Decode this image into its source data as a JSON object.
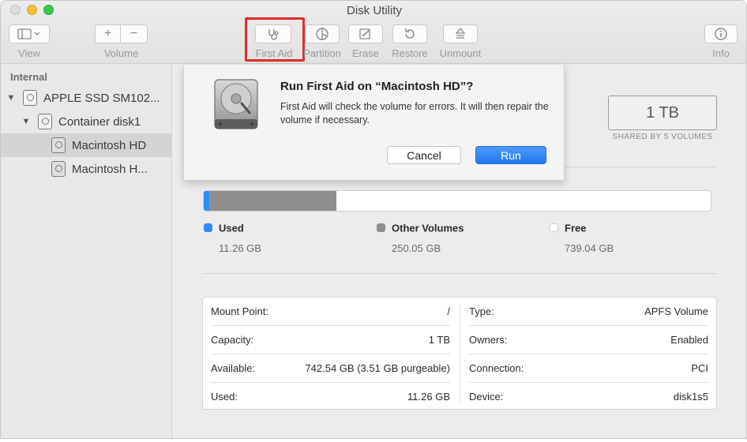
{
  "window": {
    "title": "Disk Utility"
  },
  "toolbar": {
    "view_label": "View",
    "volume_label": "Volume",
    "first_aid_label": "First Aid",
    "partition_label": "Partition",
    "erase_label": "Erase",
    "restore_label": "Restore",
    "unmount_label": "Unmount",
    "info_label": "Info"
  },
  "sidebar": {
    "section": "Internal",
    "items": [
      {
        "label": "APPLE SSD SM102..."
      },
      {
        "label": "Container disk1"
      },
      {
        "label": "Macintosh HD"
      },
      {
        "label": "Macintosh H..."
      }
    ]
  },
  "capacity": {
    "value": "1 TB",
    "subtitle": "SHARED BY 5 VOLUMES"
  },
  "usage": {
    "total_gb": 1000.35,
    "colors": {
      "used": "#2f8cf5",
      "other": "#8e8e8e",
      "free": "#ffffff"
    },
    "legend": [
      {
        "name": "Used",
        "value": "11.26 GB",
        "gb": 11.26
      },
      {
        "name": "Other Volumes",
        "value": "250.05 GB",
        "gb": 250.05
      },
      {
        "name": "Free",
        "value": "739.04 GB",
        "gb": 739.04
      }
    ]
  },
  "info": {
    "left": [
      {
        "label": "Mount Point:",
        "value": "/"
      },
      {
        "label": "Capacity:",
        "value": "1 TB"
      },
      {
        "label": "Available:",
        "value": "742.54 GB (3.51 GB purgeable)"
      },
      {
        "label": "Used:",
        "value": "11.26 GB"
      }
    ],
    "right": [
      {
        "label": "Type:",
        "value": "APFS Volume"
      },
      {
        "label": "Owners:",
        "value": "Enabled"
      },
      {
        "label": "Connection:",
        "value": "PCI"
      },
      {
        "label": "Device:",
        "value": "disk1s5"
      }
    ]
  },
  "dialog": {
    "title": "Run First Aid on “Macintosh HD”?",
    "message": "First Aid will check the volume for errors. It will then repair the volume if necessary.",
    "cancel_label": "Cancel",
    "run_label": "Run"
  }
}
